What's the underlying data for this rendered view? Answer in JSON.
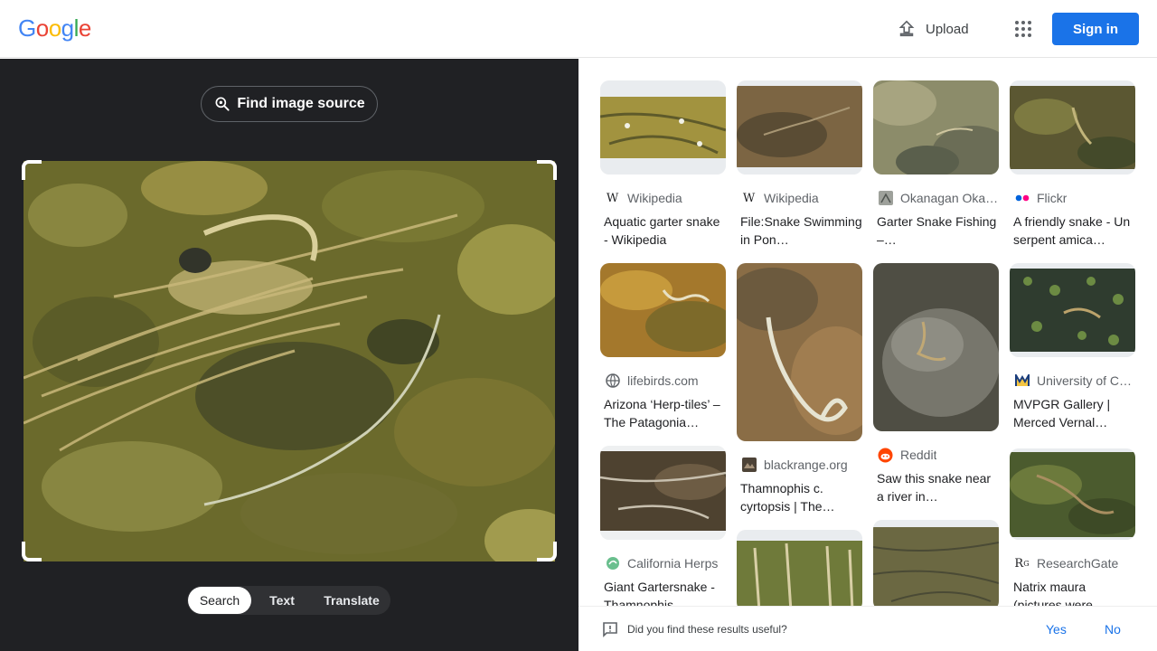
{
  "header": {
    "logo_letters": [
      "G",
      "o",
      "o",
      "g",
      "l",
      "e"
    ],
    "logo_colors": [
      "#4285f4",
      "#ea4335",
      "#fbbc05",
      "#4285f4",
      "#34a853",
      "#ea4335"
    ],
    "upload_label": "Upload",
    "signin_label": "Sign in"
  },
  "left": {
    "find_source_label": "Find image source",
    "tabs": [
      "Search",
      "Text",
      "Translate"
    ],
    "active_tab": "Search"
  },
  "results": [
    {
      "source": "Wikipedia",
      "icon": "wikipedia-icon",
      "title": "Aquatic garter snake - Wikipedia"
    },
    {
      "source": "Wikipedia",
      "icon": "wikipedia-icon",
      "title": "File:Snake Swimming in Pon…"
    },
    {
      "source": "Okanagan Oka…",
      "icon": "okanagan-icon",
      "title": "Garter Snake Fishing –…"
    },
    {
      "source": "Flickr",
      "icon": "flickr-icon",
      "title": "A friendly snake - Un serpent amica…"
    },
    {
      "source": "lifebirds.com",
      "icon": "globe-icon",
      "title": "Arizona ‘Herp-tiles’ – The Patagonia…"
    },
    {
      "source": "blackrange.org",
      "icon": "blackrange-icon",
      "title": "Thamnophis c. cyrtopsis | The…"
    },
    {
      "source": "Reddit",
      "icon": "reddit-icon",
      "title": "Saw this snake near a river in…"
    },
    {
      "source": "University of C…",
      "icon": "university-icon",
      "title": "MVPGR Gallery | Merced Vernal…"
    },
    {
      "source": "California Herps",
      "icon": "california-herps-icon",
      "title": "Giant Gartersnake - Thamnophis…"
    },
    {
      "source": "ResearchGate",
      "icon": "researchgate-icon",
      "title": "Natrix maura (pictures were…"
    }
  ],
  "feedback": {
    "question": "Did you find these results useful?",
    "yes": "Yes",
    "no": "No"
  }
}
